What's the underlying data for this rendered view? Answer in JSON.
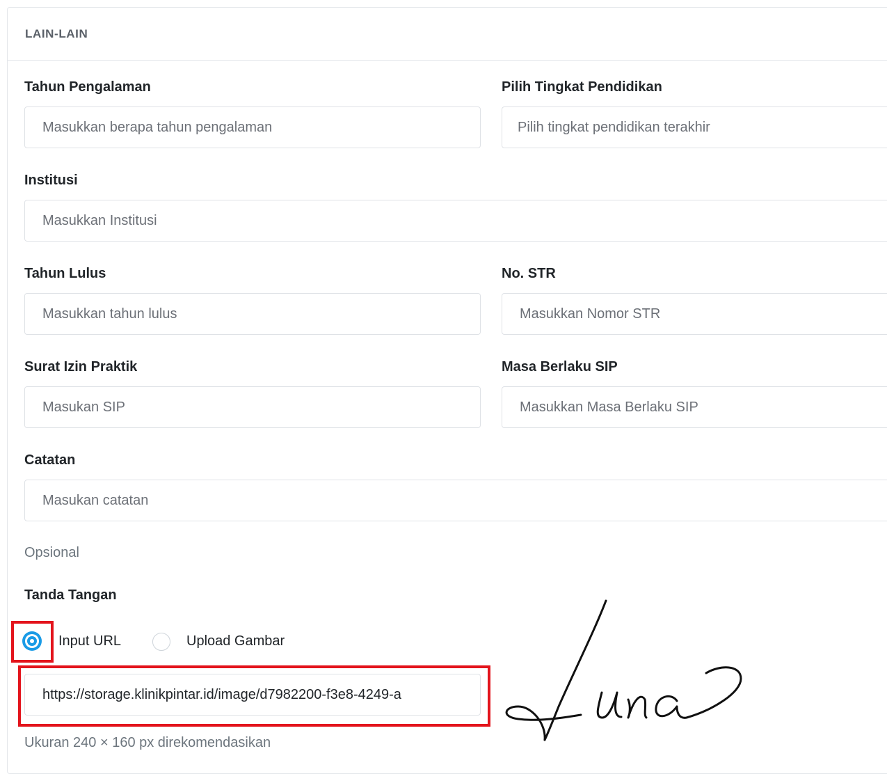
{
  "section": {
    "title": "LAIN-LAIN"
  },
  "fields": {
    "experience": {
      "label": "Tahun Pengalaman",
      "placeholder": "Masukkan berapa tahun pengalaman"
    },
    "education": {
      "label": "Pilih Tingkat Pendidikan",
      "placeholder": "Pilih tingkat pendidikan terakhir"
    },
    "institution": {
      "label": "Institusi",
      "placeholder": "Masukkan Institusi"
    },
    "graduation_year": {
      "label": "Tahun Lulus",
      "placeholder": "Masukkan tahun lulus"
    },
    "str_number": {
      "label": "No. STR",
      "placeholder": "Masukkan Nomor STR"
    },
    "sip": {
      "label": "Surat Izin Praktik",
      "placeholder": "Masukan SIP"
    },
    "sip_validity": {
      "label": "Masa Berlaku SIP",
      "placeholder": "Masukkan Masa Berlaku SIP"
    },
    "notes": {
      "label": "Catatan",
      "placeholder": "Masukan catatan",
      "help": "Opsional"
    }
  },
  "signature": {
    "label": "Tanda Tangan",
    "options": [
      {
        "label": "Input URL",
        "selected": true
      },
      {
        "label": "Upload Gambar",
        "selected": false
      }
    ],
    "url_value": "https://storage.klinikpintar.id/image/d7982200-f3e8-4249-a",
    "help": "Ukuran 240 × 160 px direkomendasikan",
    "preview_text": "Luna"
  },
  "colors": {
    "accent": "#1a9be6",
    "highlight": "#e3141c",
    "border": "#dfe2e6"
  }
}
